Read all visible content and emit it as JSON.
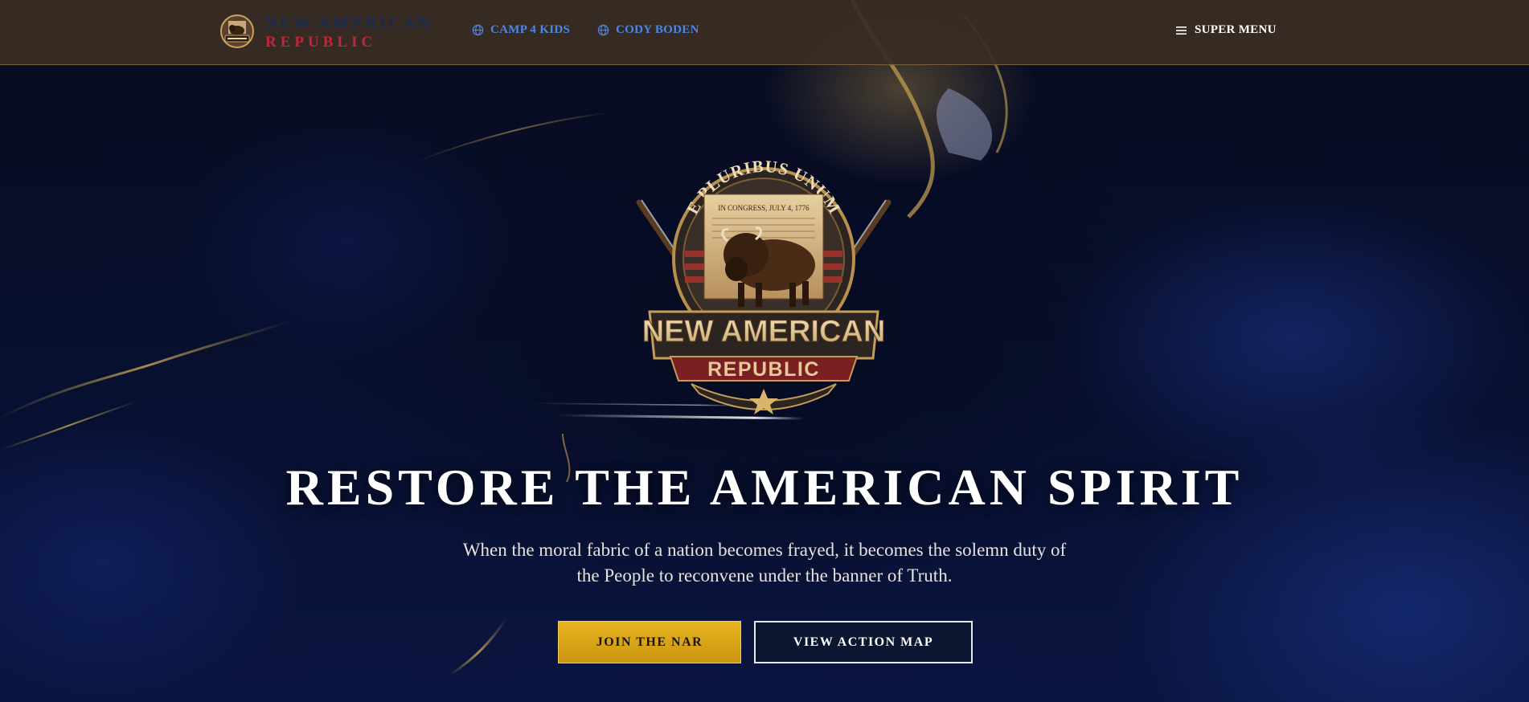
{
  "header": {
    "brand": {
      "line1": "NEW AMERICAN",
      "line2": "REPUBLIC"
    },
    "nav": [
      {
        "label": "CAMP 4 KIDS",
        "icon": "globe-icon"
      },
      {
        "label": "CODY BODEN",
        "icon": "globe-icon"
      }
    ],
    "menu": {
      "label": "SUPER MENU",
      "icon": "hamburger-icon"
    }
  },
  "hero": {
    "emblem": {
      "arc_text": "E PLURIBUS UNUM",
      "document_text": "IN CONGRESS, JULY 4, 1776",
      "banner_line1": "NEW AMERICAN",
      "banner_line2": "REPUBLIC"
    },
    "title": "RESTORE THE AMERICAN SPIRIT",
    "subtitle": "When the moral fabric of a nation becomes frayed, it becomes the solemn duty of the People to reconvene under the banner of Truth.",
    "buttons": {
      "primary": "JOIN THE NAR",
      "secondary": "VIEW ACTION MAP"
    }
  },
  "colors": {
    "header_bg": "#3a2e24",
    "brand_navy": "#1c2a4e",
    "brand_red": "#c4253a",
    "nav_link": "#4c86e6",
    "gold_button": "#e0aa18",
    "hero_bg": "#070b1f"
  }
}
